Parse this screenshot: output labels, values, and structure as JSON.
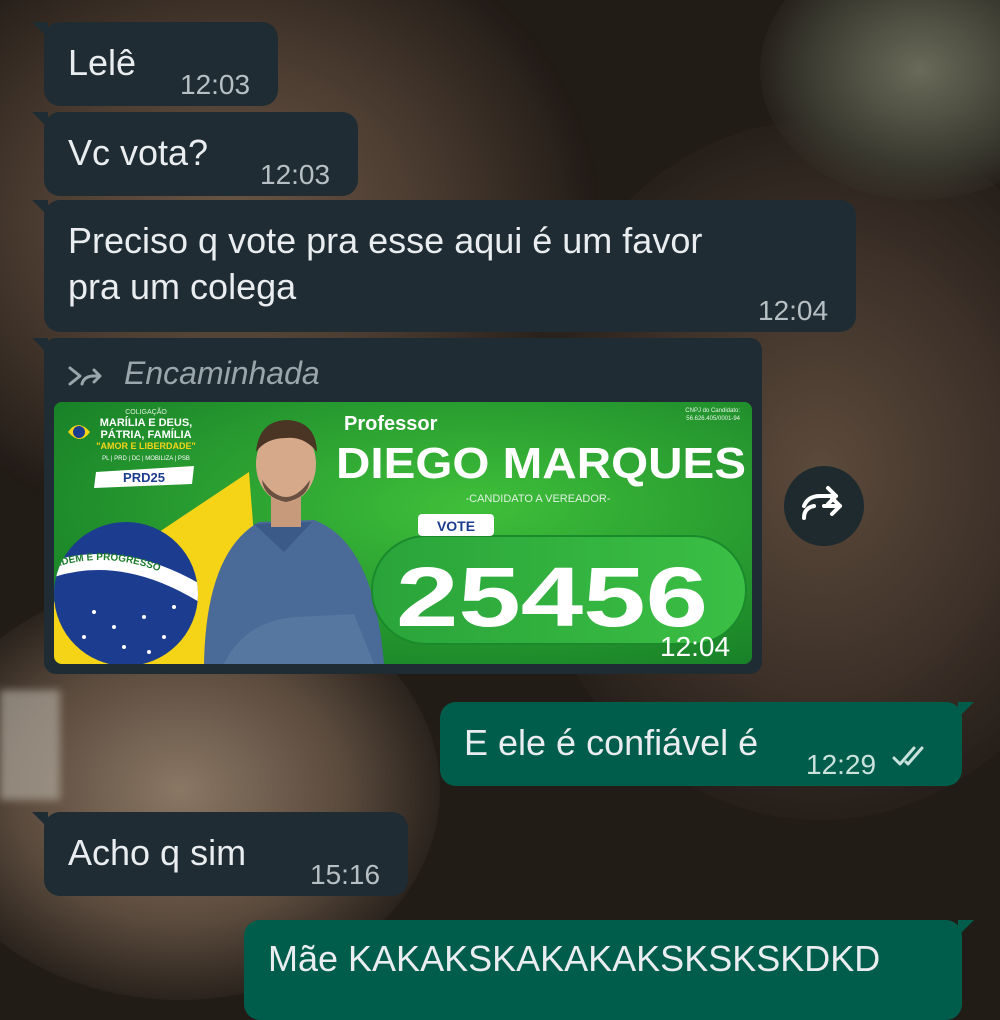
{
  "messages": [
    {
      "text": "Lelê",
      "time": "12:03"
    },
    {
      "text": "Vc vota?",
      "time": "12:03"
    },
    {
      "text": "Preciso q vote pra esse aqui é um favor\npra um colega",
      "time": "12:04"
    },
    {
      "forwarded_label": "Encaminhada",
      "time": "12:04",
      "image": {
        "coalition_small": "COLIGAÇÃO",
        "coalition_line1": "MARÍLIA E DEUS,",
        "coalition_line2": "PÁTRIA, FAMÍLIA",
        "coalition_line3": "\"AMOR E LIBERDADE\"",
        "coalition_parties": "PL | PRD | DC | MOBILIZA | PSB",
        "party": "PRD25",
        "cnpj": "CNPJ do Candidato:",
        "cnpj_number": "56.626.405/0001-94",
        "title": "Professor",
        "name": "DIEGO MARQUES",
        "role": "-CANDIDATO A VEREADOR-",
        "vote_label": "VOTE",
        "number": "25456",
        "flag_motto": "ORDEM E PROGRESSO"
      }
    },
    {
      "text": "E ele é confiável é",
      "time": "12:29",
      "status": "read"
    },
    {
      "text": "Acho q sim",
      "time": "15:16"
    },
    {
      "text": "Mãe KAKAKSKAKAKAKSKSKSKDKD"
    }
  ],
  "colors": {
    "incoming_bubble": "#1f2c33",
    "outgoing_bubble": "#005c4b",
    "text": "#e9edef",
    "poster_green": "#1f8f32",
    "poster_yellow": "#f5d418",
    "poster_blue": "#1c3d8f"
  },
  "icons": [
    "forward-icon",
    "forward-button-icon",
    "read-ticks-icon"
  ]
}
